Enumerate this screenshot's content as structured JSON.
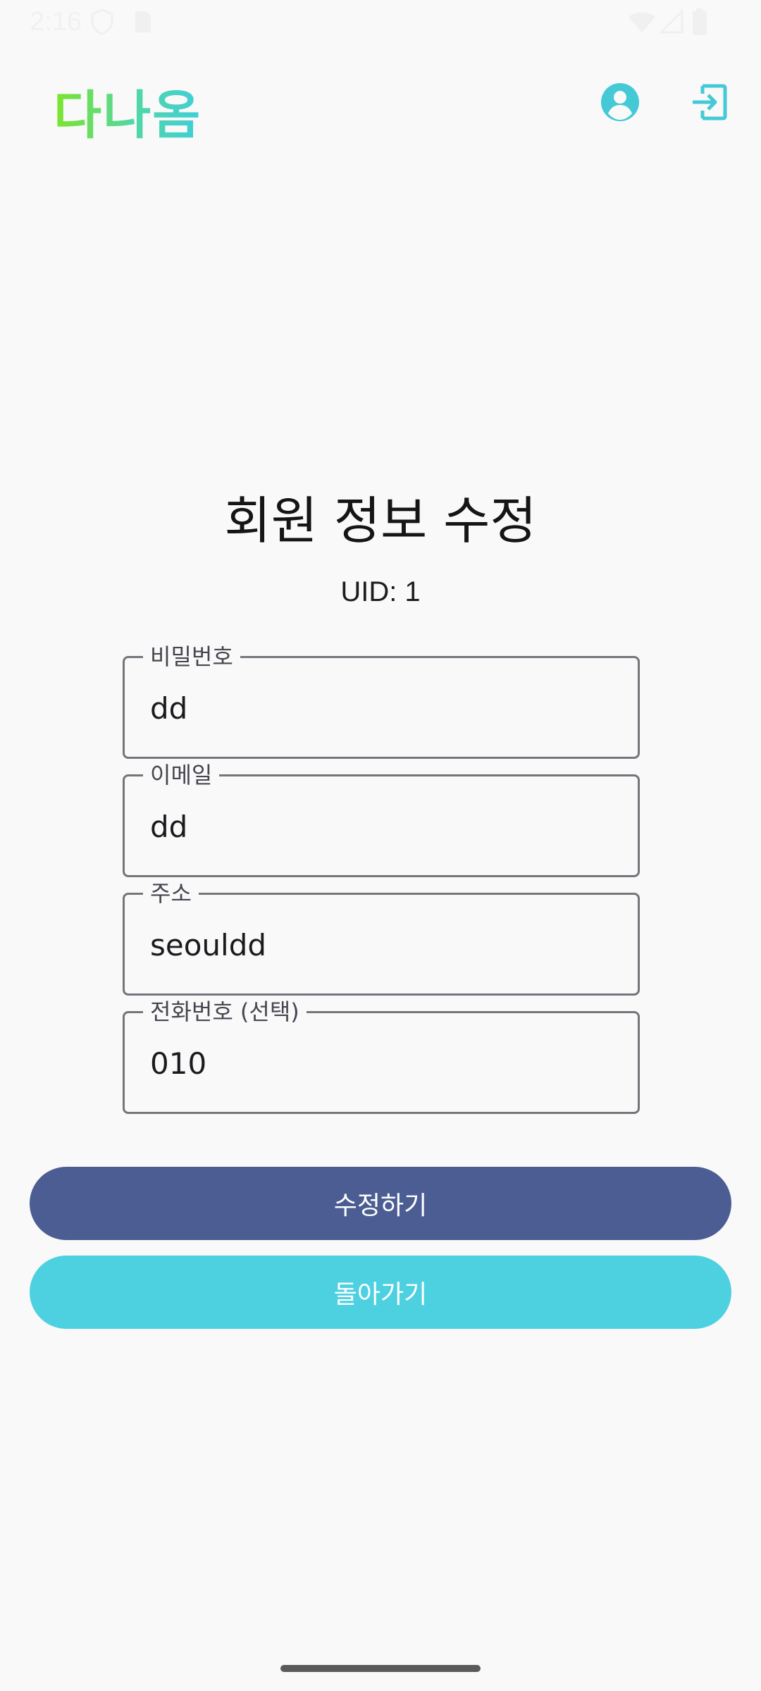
{
  "status_bar": {
    "time": "2:16",
    "icons": [
      "shield-icon",
      "sim-icon",
      "wifi-icon",
      "signal-icon",
      "battery-icon"
    ]
  },
  "app_bar": {
    "brand": "다나옴",
    "icons": [
      "account-circle-icon",
      "login-icon"
    ],
    "icon_color": "#45c9d6"
  },
  "page": {
    "title": "회원 정보 수정",
    "uid": "UID: 1"
  },
  "form": {
    "password": {
      "label": "비밀번호",
      "value": "dd"
    },
    "email": {
      "label": "이메일",
      "value": "dd"
    },
    "address": {
      "label": "주소",
      "value": "seouldd"
    },
    "phone": {
      "label": "전화번호 (선택)",
      "value": "010"
    }
  },
  "actions": {
    "submit_label": "수정하기",
    "back_label": "돌아가기"
  },
  "colors": {
    "primary": "#4b5d92",
    "secondary": "#4dd1e1",
    "background": "#f9f9f9"
  }
}
